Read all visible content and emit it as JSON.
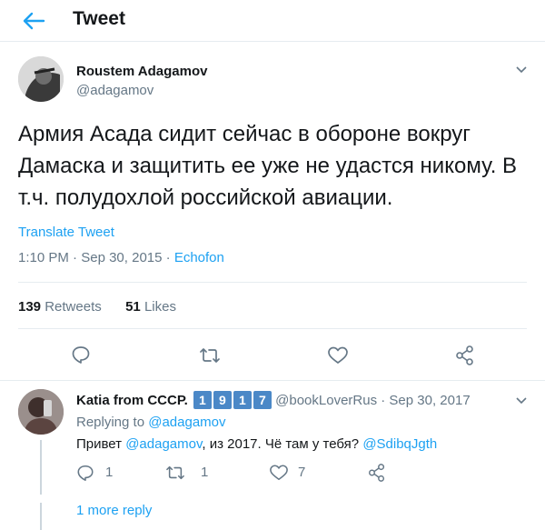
{
  "header": {
    "title": "Tweet"
  },
  "tweet": {
    "author_name": "Roustem Adagamov",
    "author_handle": "@adagamov",
    "text": "Армия Асада сидит сейчас в обороне вокруг Дамаска и защитить ее уже не удастся никому. В т.ч. полудохлой российской авиации.",
    "translate_label": "Translate Tweet",
    "time": "1:10 PM",
    "date": "Sep 30, 2015",
    "sep": "·",
    "source": "Echofon",
    "retweets_count": "139",
    "retweets_label": "Retweets",
    "likes_count": "51",
    "likes_label": "Likes"
  },
  "reply": {
    "author_name": "Katia from СССР.",
    "badges": [
      "1",
      "9",
      "1",
      "7"
    ],
    "author_handle": "@bookLoverRus",
    "sep": "·",
    "date": "Sep 30, 2017",
    "replying_prefix": "Replying to",
    "replying_handle": "@adagamov",
    "text_prefix": "Привет",
    "text_mention": "@adagamov",
    "text_middle": ", из 2017. Чё там у тебя?",
    "text_mention2": "@SdibqJgth",
    "reply_count": "1",
    "retweet_count": "1",
    "like_count": "7",
    "more_replies": "1 more reply"
  },
  "colors": {
    "accent": "#1da1f2",
    "muted": "#657786",
    "divider": "#e6ecf0"
  },
  "icons": [
    "back-arrow-icon",
    "chevron-down-icon",
    "reply-icon",
    "retweet-icon",
    "like-icon",
    "share-icon"
  ]
}
